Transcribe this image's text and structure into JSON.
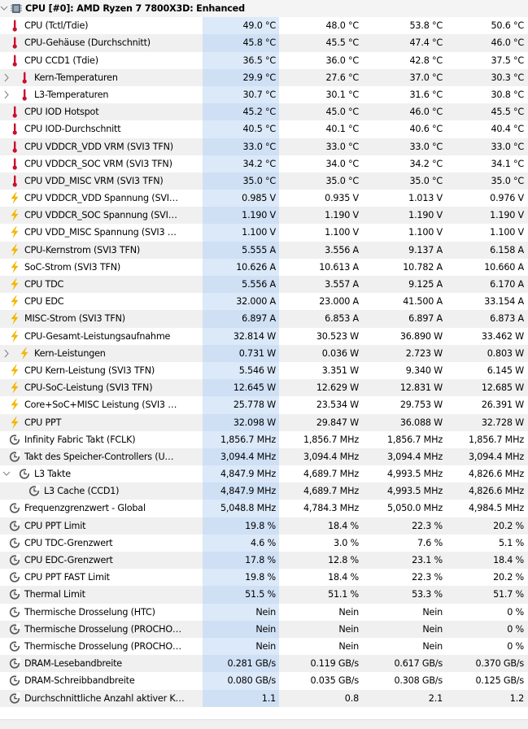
{
  "section": {
    "title": "CPU [#0]: AMD Ryzen 7 7800X3D: Enhanced"
  },
  "rows": [
    {
      "label": "CPU (Tctl/Tdie)",
      "icon": "thermometer-icon",
      "indent": 0,
      "expander": "",
      "values": [
        "49.0 °C",
        "48.0 °C",
        "53.8 °C",
        "50.6 °C"
      ]
    },
    {
      "label": "CPU-Gehäuse (Durchschnitt)",
      "icon": "thermometer-icon",
      "indent": 0,
      "expander": "",
      "values": [
        "45.8 °C",
        "45.5 °C",
        "47.4 °C",
        "46.0 °C"
      ]
    },
    {
      "label": "CPU CCD1 (Tdie)",
      "icon": "thermometer-icon",
      "indent": 0,
      "expander": "",
      "values": [
        "36.5 °C",
        "36.0 °C",
        "42.8 °C",
        "37.5 °C"
      ]
    },
    {
      "label": "Kern-Temperaturen",
      "icon": "thermometer-icon",
      "indent": 1,
      "expander": "collapsed",
      "values": [
        "29.9 °C",
        "27.6 °C",
        "37.0 °C",
        "30.3 °C"
      ]
    },
    {
      "label": "L3-Temperaturen",
      "icon": "thermometer-icon",
      "indent": 1,
      "expander": "collapsed",
      "values": [
        "30.7 °C",
        "30.1 °C",
        "31.6 °C",
        "30.8 °C"
      ]
    },
    {
      "label": "CPU IOD Hotspot",
      "icon": "thermometer-icon",
      "indent": 0,
      "expander": "",
      "values": [
        "45.2 °C",
        "45.0 °C",
        "46.0 °C",
        "45.5 °C"
      ]
    },
    {
      "label": "CPU IOD-Durchschnitt",
      "icon": "thermometer-icon",
      "indent": 0,
      "expander": "",
      "values": [
        "40.5 °C",
        "40.1 °C",
        "40.6 °C",
        "40.4 °C"
      ]
    },
    {
      "label": "CPU VDDCR_VDD VRM (SVI3 TFN)",
      "icon": "thermometer-icon",
      "indent": 0,
      "expander": "",
      "values": [
        "33.0 °C",
        "33.0 °C",
        "33.0 °C",
        "33.0 °C"
      ]
    },
    {
      "label": "CPU VDDCR_SOC VRM (SVI3 TFN)",
      "icon": "thermometer-icon",
      "indent": 0,
      "expander": "",
      "values": [
        "34.2 °C",
        "34.0 °C",
        "34.2 °C",
        "34.1 °C"
      ]
    },
    {
      "label": "CPU VDD_MISC VRM (SVI3 TFN)",
      "icon": "thermometer-icon",
      "indent": 0,
      "expander": "",
      "values": [
        "35.0 °C",
        "35.0 °C",
        "35.0 °C",
        "35.0 °C"
      ]
    },
    {
      "label": "CPU VDDCR_VDD Spannung (SVI…",
      "icon": "lightning-icon",
      "indent": 0,
      "expander": "",
      "values": [
        "0.985 V",
        "0.935 V",
        "1.013 V",
        "0.976 V"
      ]
    },
    {
      "label": "CPU VDDCR_SOC Spannung (SVI…",
      "icon": "lightning-icon",
      "indent": 0,
      "expander": "",
      "values": [
        "1.190 V",
        "1.190 V",
        "1.190 V",
        "1.190 V"
      ]
    },
    {
      "label": "CPU VDD_MISC Spannung (SVI3 …",
      "icon": "lightning-icon",
      "indent": 0,
      "expander": "",
      "values": [
        "1.100 V",
        "1.100 V",
        "1.100 V",
        "1.100 V"
      ]
    },
    {
      "label": "CPU-Kernstrom (SVI3 TFN)",
      "icon": "lightning-icon",
      "indent": 0,
      "expander": "",
      "values": [
        "5.555 A",
        "3.556 A",
        "9.137 A",
        "6.158 A"
      ]
    },
    {
      "label": "SoC-Strom (SVI3 TFN)",
      "icon": "lightning-icon",
      "indent": 0,
      "expander": "",
      "values": [
        "10.626 A",
        "10.613 A",
        "10.782 A",
        "10.660 A"
      ]
    },
    {
      "label": "CPU TDC",
      "icon": "lightning-icon",
      "indent": 0,
      "expander": "",
      "values": [
        "5.556 A",
        "3.557 A",
        "9.125 A",
        "6.170 A"
      ]
    },
    {
      "label": "CPU EDC",
      "icon": "lightning-icon",
      "indent": 0,
      "expander": "",
      "values": [
        "32.000 A",
        "23.000 A",
        "41.500 A",
        "33.154 A"
      ]
    },
    {
      "label": "MISC-Strom (SVI3 TFN)",
      "icon": "lightning-icon",
      "indent": 0,
      "expander": "",
      "values": [
        "6.897 A",
        "6.853 A",
        "6.897 A",
        "6.873 A"
      ]
    },
    {
      "label": "CPU-Gesamt-Leistungsaufnahme",
      "icon": "lightning-icon",
      "indent": 0,
      "expander": "",
      "values": [
        "32.814 W",
        "30.523 W",
        "36.890 W",
        "33.462 W"
      ]
    },
    {
      "label": "Kern-Leistungen",
      "icon": "lightning-icon",
      "indent": 1,
      "expander": "collapsed",
      "values": [
        "0.731 W",
        "0.036 W",
        "2.723 W",
        "0.803 W"
      ]
    },
    {
      "label": "CPU Kern-Leistung (SVI3 TFN)",
      "icon": "lightning-icon",
      "indent": 0,
      "expander": "",
      "values": [
        "5.546 W",
        "3.351 W",
        "9.340 W",
        "6.145 W"
      ]
    },
    {
      "label": "CPU-SoC-Leistung (SVI3 TFN)",
      "icon": "lightning-icon",
      "indent": 0,
      "expander": "",
      "values": [
        "12.645 W",
        "12.629 W",
        "12.831 W",
        "12.685 W"
      ]
    },
    {
      "label": "Core+SoC+MISC Leistung (SVI3 …",
      "icon": "lightning-icon",
      "indent": 0,
      "expander": "",
      "values": [
        "25.778 W",
        "23.534 W",
        "29.753 W",
        "26.391 W"
      ]
    },
    {
      "label": "CPU PPT",
      "icon": "lightning-icon",
      "indent": 0,
      "expander": "",
      "values": [
        "32.098 W",
        "29.847 W",
        "36.088 W",
        "32.728 W"
      ]
    },
    {
      "label": "Infinity Fabric Takt (FCLK)",
      "icon": "clock-icon",
      "indent": 0,
      "expander": "",
      "values": [
        "1,856.7 MHz",
        "1,856.7 MHz",
        "1,856.7 MHz",
        "1,856.7 MHz"
      ]
    },
    {
      "label": "Takt des Speicher-Controllers (U…",
      "icon": "clock-icon",
      "indent": 0,
      "expander": "",
      "values": [
        "3,094.4 MHz",
        "3,094.4 MHz",
        "3,094.4 MHz",
        "3,094.4 MHz"
      ]
    },
    {
      "label": "L3 Takte",
      "icon": "clock-icon",
      "indent": 1,
      "expander": "expanded",
      "values": [
        "4,847.9 MHz",
        "4,689.7 MHz",
        "4,993.5 MHz",
        "4,826.6 MHz"
      ]
    },
    {
      "label": "L3 Cache (CCD1)",
      "icon": "clock-icon",
      "indent": 2,
      "expander": "",
      "values": [
        "4,847.9 MHz",
        "4,689.7 MHz",
        "4,993.5 MHz",
        "4,826.6 MHz"
      ]
    },
    {
      "label": "Frequenzgrenzwert - Global",
      "icon": "clock-icon",
      "indent": 0,
      "expander": "",
      "values": [
        "5,048.8 MHz",
        "4,784.3 MHz",
        "5,050.0 MHz",
        "4,984.5 MHz"
      ]
    },
    {
      "label": "CPU PPT Limit",
      "icon": "clock-icon",
      "indent": 0,
      "expander": "",
      "values": [
        "19.8 %",
        "18.4 %",
        "22.3 %",
        "20.2 %"
      ]
    },
    {
      "label": "CPU TDC-Grenzwert",
      "icon": "clock-icon",
      "indent": 0,
      "expander": "",
      "values": [
        "4.6 %",
        "3.0 %",
        "7.6 %",
        "5.1 %"
      ]
    },
    {
      "label": "CPU EDC-Grenzwert",
      "icon": "clock-icon",
      "indent": 0,
      "expander": "",
      "values": [
        "17.8 %",
        "12.8 %",
        "23.1 %",
        "18.4 %"
      ]
    },
    {
      "label": "CPU PPT FAST Limit",
      "icon": "clock-icon",
      "indent": 0,
      "expander": "",
      "values": [
        "19.8 %",
        "18.4 %",
        "22.3 %",
        "20.2 %"
      ]
    },
    {
      "label": "Thermal Limit",
      "icon": "clock-icon",
      "indent": 0,
      "expander": "",
      "values": [
        "51.5 %",
        "51.1 %",
        "53.3 %",
        "51.7 %"
      ]
    },
    {
      "label": "Thermische Drosselung (HTC)",
      "icon": "clock-icon",
      "indent": 0,
      "expander": "",
      "values": [
        "Nein",
        "Nein",
        "Nein",
        "0 %"
      ]
    },
    {
      "label": "Thermische Drosselung (PROCHO…",
      "icon": "clock-icon",
      "indent": 0,
      "expander": "",
      "values": [
        "Nein",
        "Nein",
        "Nein",
        "0 %"
      ]
    },
    {
      "label": "Thermische Drosselung (PROCHO…",
      "icon": "clock-icon",
      "indent": 0,
      "expander": "",
      "values": [
        "Nein",
        "Nein",
        "Nein",
        "0 %"
      ]
    },
    {
      "label": "DRAM-Lesebandbreite",
      "icon": "clock-icon",
      "indent": 0,
      "expander": "",
      "values": [
        "0.281 GB/s",
        "0.119 GB/s",
        "0.617 GB/s",
        "0.370 GB/s"
      ]
    },
    {
      "label": "DRAM-Schreibbandbreite",
      "icon": "clock-icon",
      "indent": 0,
      "expander": "",
      "values": [
        "0.080 GB/s",
        "0.035 GB/s",
        "0.308 GB/s",
        "0.125 GB/s"
      ]
    },
    {
      "label": "Durchschnittliche Anzahl aktiver K…",
      "icon": "clock-icon",
      "indent": 0,
      "expander": "",
      "values": [
        "1.1",
        "0.8",
        "2.1",
        "1.2"
      ]
    }
  ],
  "colors": {
    "current_column_bg": "#dbe9f9",
    "thermometer": "#c8102e",
    "lightning": "#f2b600",
    "clock": "#555555"
  }
}
